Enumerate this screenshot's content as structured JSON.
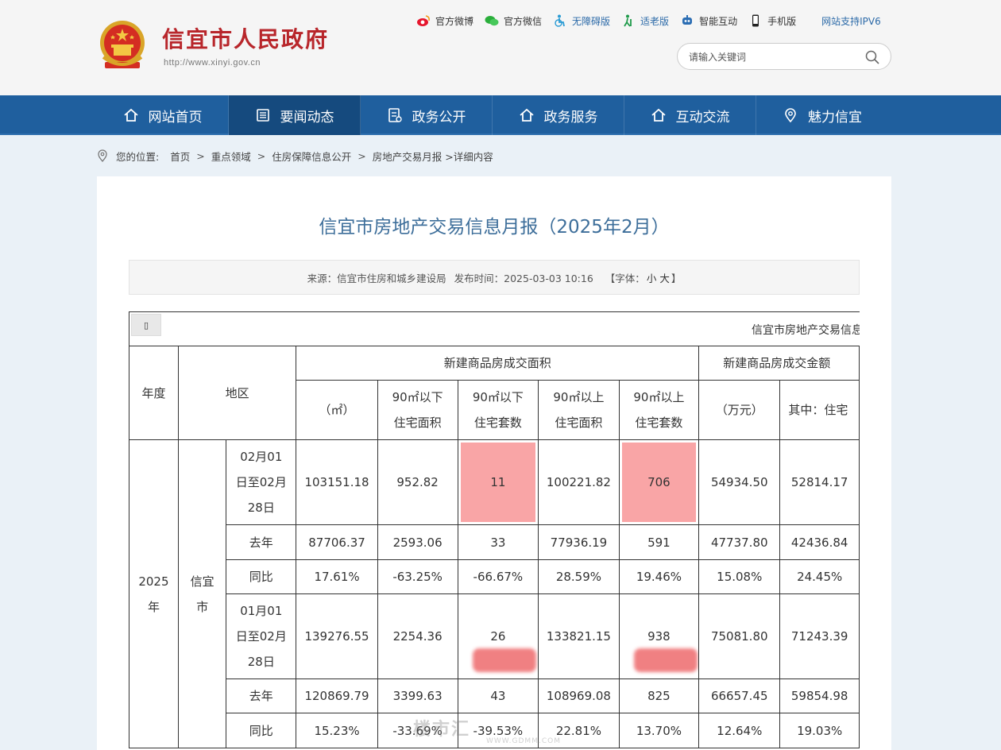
{
  "header": {
    "site_title": "信宜市人民政府",
    "site_url": "http://www.xinyi.gov.cn",
    "top_links": [
      {
        "label": "官方微博",
        "icon": "weibo-icon"
      },
      {
        "label": "官方微信",
        "icon": "wechat-icon"
      },
      {
        "label": "无障碍版",
        "icon": "accessibility-icon"
      },
      {
        "label": "适老版",
        "icon": "elderly-icon"
      },
      {
        "label": "智能互动",
        "icon": "robot-icon"
      },
      {
        "label": "手机版",
        "icon": "mobile-icon"
      },
      {
        "label": "网站支持IPV6",
        "icon": ""
      }
    ],
    "search_placeholder": "请输入关键词"
  },
  "nav": {
    "items": [
      {
        "label": "网站首页"
      },
      {
        "label": "要闻动态"
      },
      {
        "label": "政务公开"
      },
      {
        "label": "政务服务"
      },
      {
        "label": "互动交流"
      },
      {
        "label": "魅力信宜"
      }
    ],
    "active_index": 1
  },
  "breadcrumb": {
    "prefix": "您的位置:",
    "items": [
      "首页",
      "重点领域",
      "住房保障信息公开",
      "房地产交易月报"
    ],
    "suffix": ">详细内容"
  },
  "article": {
    "title": "信宜市房地产交易信息月报（2025年2月）",
    "source": "来源：信宜市住房和城乡建设局",
    "publish_time": "发布时间：2025-03-03 10:16",
    "font_label_open": "【字体：",
    "font_small": "小",
    "font_large": "大",
    "font_label_close": "】"
  },
  "table": {
    "toolbar_button": "▯",
    "caption": "信宜市房地产交易信息",
    "header": {
      "year": "年度",
      "region": "地区",
      "group_area": "新建商品房成交面积",
      "group_amount": "新建商品房成交金额",
      "col_area": "（㎡）",
      "col_below90_area": "90㎡以下 住宅面积",
      "col_below90_units": "90㎡以下 住宅套数",
      "col_above90_area": "90㎡以上 住宅面积",
      "col_above90_units": "90㎡以上 住宅套数",
      "col_amount": "（万元）",
      "col_amount_res": "其中：住宅"
    },
    "year_cell": "2025 年",
    "region_cell": "信宜 市",
    "rows": [
      {
        "period": "02月01 日至02月 28日",
        "v": [
          "103151.18",
          "952.82",
          "11",
          "100221.82",
          "706",
          "54934.50",
          "52814.17"
        ]
      },
      {
        "period": "去年",
        "v": [
          "87706.37",
          "2593.06",
          "33",
          "77936.19",
          "591",
          "47737.80",
          "42436.84"
        ]
      },
      {
        "period": "同比",
        "v": [
          "17.61%",
          "-63.25%",
          "-66.67%",
          "28.59%",
          "19.46%",
          "15.08%",
          "24.45%"
        ]
      },
      {
        "period": "01月01 日至02月 28日",
        "v": [
          "139276.55",
          "2254.36",
          "26",
          "133821.15",
          "938",
          "75081.80",
          "71243.39"
        ]
      },
      {
        "period": "去年",
        "v": [
          "120869.79",
          "3399.63",
          "43",
          "108969.08",
          "825",
          "66657.45",
          "59854.98"
        ]
      },
      {
        "period": "同比",
        "v": [
          "15.23%",
          "-33.69%",
          "-39.53%",
          "22.81%",
          "13.70%",
          "12.64%",
          "19.03%"
        ]
      }
    ]
  },
  "watermark": {
    "main": "楼市汇",
    "sub": "WWW.GDMM.COM"
  },
  "colors": {
    "nav": "#1f5f9e",
    "nav_active": "#154a7e",
    "title_red": "#b8262b",
    "highlight": "#f9a5a6"
  }
}
